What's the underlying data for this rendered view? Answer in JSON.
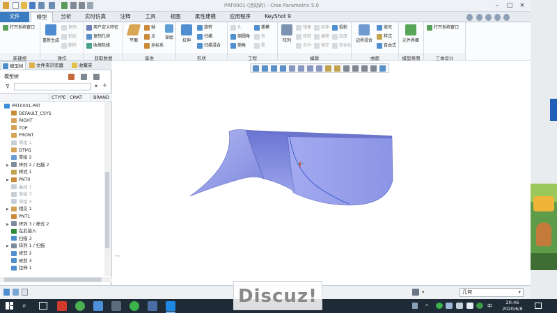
{
  "window": {
    "title": "PRT0001 (活动的) - Creo Parametric 5.0"
  },
  "tabs": [
    "文件",
    "模型",
    "分析",
    "实时仿真",
    "注释",
    "工具",
    "视图",
    "柔性建模",
    "应用程序",
    "KeyShot 9"
  ],
  "active_tab": "模型",
  "ribbon": {
    "groups": [
      {
        "label": "新建组",
        "items": [
          "打开系统窗口"
        ]
      },
      {
        "label": "操作",
        "big": "重新生成",
        "items": [
          "复制",
          "粘贴",
          "删除"
        ]
      },
      {
        "label": "获取数据",
        "items": [
          "用户定义特征",
          "复制几何",
          "收缩包络"
        ]
      },
      {
        "label": "基准",
        "big": "平面",
        "items": [
          "轴",
          "点",
          "坐标系"
        ],
        "extra": "草绘"
      },
      {
        "label": "形状",
        "big": "拉伸",
        "items": [
          "旋转",
          "扫描",
          "扫描混合"
        ]
      },
      {
        "label": "工程",
        "items": [
          "孔",
          "倒圆角",
          "倒角",
          "拔模",
          "壳",
          "筋"
        ]
      },
      {
        "label": "编辑",
        "big": "阵列",
        "items": [
          "镜像",
          "修剪",
          "合并",
          "延伸",
          "偏移",
          "相交",
          "投影",
          "加厚",
          "实体化"
        ]
      },
      {
        "label": "曲面",
        "big": "边界混合",
        "items": [
          "填充",
          "样式",
          "自由式"
        ]
      },
      {
        "label": "模型意图",
        "big": "元件界面"
      },
      {
        "label": "三体设计",
        "items": [
          "打开系统窗口"
        ]
      }
    ]
  },
  "left_panel": {
    "tabs": [
      "模型树",
      "文件夹浏览器",
      "收藏夹"
    ],
    "header": "模型树",
    "columns": [
      "CTYPE",
      "CMAT",
      "BRAND"
    ],
    "items": [
      {
        "label": "PRT0001.PRT",
        "icon": "part-icon",
        "dim": false
      },
      {
        "label": "DEFAULT_CSYS",
        "icon": "csys-icon",
        "dim": false
      },
      {
        "label": "RIGHT",
        "icon": "plane-icon",
        "dim": false
      },
      {
        "label": "TOP",
        "icon": "plane-icon",
        "dim": false
      },
      {
        "label": "FRONT",
        "icon": "plane-icon",
        "dim": false
      },
      {
        "label": "草绘 1",
        "icon": "sketch-icon",
        "dim": true
      },
      {
        "label": "DTM1",
        "icon": "plane-icon",
        "dim": false
      },
      {
        "label": "草绘 2",
        "icon": "sketch-icon",
        "dim": false
      },
      {
        "label": "阵列 2 / 扫描 2",
        "icon": "pattern-icon",
        "dim": false,
        "expand": true
      },
      {
        "label": "样式 1",
        "icon": "style-icon",
        "dim": false
      },
      {
        "label": "PNT0",
        "icon": "point-icon",
        "dim": false,
        "expand": true
      },
      {
        "label": "曲线 1",
        "icon": "curve-icon",
        "dim": true
      },
      {
        "label": "草绘 3",
        "icon": "sketch-icon",
        "dim": true
      },
      {
        "label": "草绘 4",
        "icon": "sketch-icon",
        "dim": true
      },
      {
        "label": "相交 1",
        "icon": "intersect-icon",
        "dim": false,
        "expand": true
      },
      {
        "label": "PNT1",
        "icon": "point-icon",
        "dim": false
      },
      {
        "label": "阵列 3 / 样式 2",
        "icon": "pattern-icon",
        "dim": false,
        "expand": true
      },
      {
        "label": "在此插入",
        "icon": "insert-arrow-icon",
        "dim": false
      },
      {
        "label": "扫描 3",
        "icon": "sweep-icon",
        "dim": false
      },
      {
        "label": "阵列 1 / 扫描",
        "icon": "pattern-icon",
        "dim": false,
        "expand": true
      },
      {
        "label": "修剪 2",
        "icon": "trim-icon",
        "dim": false
      },
      {
        "label": "修剪 3",
        "icon": "trim-icon",
        "dim": false
      },
      {
        "label": "拉伸 1",
        "icon": "extrude-icon",
        "dim": false
      }
    ]
  },
  "status": {
    "filter": "几何"
  },
  "taskbar": {
    "time": "20:46",
    "date": "2020/6/8"
  },
  "watermark": "Discuz!",
  "colors": {
    "accent": "#3a7cc2",
    "surface": "#9aa4ec",
    "surface_dark": "#5b66c6",
    "taskbar": "#1f2b37"
  }
}
